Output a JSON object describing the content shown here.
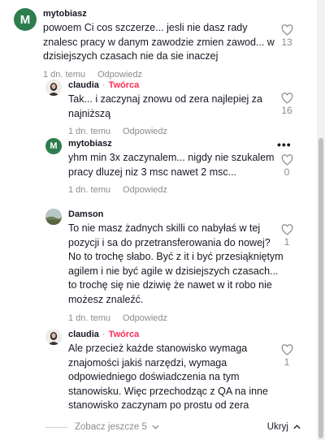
{
  "comments": [
    {
      "username": "mytobiasz",
      "avatar_letter": "M",
      "text": "powoem Ci cos szczerze... jesli nie dasz rady znalesc pracy w danym zawodzie zmien zawod... w dzisiejszych czasach nie da sie inaczej",
      "time": "1 dn. temu",
      "reply": "Odpowiedz",
      "likes": "13"
    },
    {
      "username": "claudia",
      "badge": "Twórca",
      "text": "Tak... i zaczynaj znowu od zera najlepiej za najniższą",
      "time": "1 dn. temu",
      "reply": "Odpowiedz",
      "likes": "16"
    },
    {
      "username": "mytobiasz",
      "avatar_letter": "M",
      "text": "yhm min 3x zaczynalem... nigdy nie szukalem pracy dluzej niz 3 msc nawet 2 msc...",
      "time": "1 dn. temu",
      "reply": "Odpowiedz",
      "likes": "0",
      "more": "•••"
    },
    {
      "username": "Damson",
      "text": "To nie masz żadnych skilli co nabyłaś w tej pozycji i sa do przetransferowania do nowej? No to trochę słabo. Być z it i być przesiąkniętym agilem i nie być agile w dzisiejszych czasach... to trochę się nie dziwię że nawet w it robo nie możesz znaleźć.",
      "time": "1 dn. temu",
      "reply": "Odpowiedz",
      "likes": "1"
    },
    {
      "username": "claudia",
      "badge": "Twórca",
      "text": "Ale przecież każde stanowisko wymaga znajomości jakiś narzędzi, wymaga odpowiedniego doświadczenia na tym stanowisku. Więc przechodząc z QA na inne stanowisko zaczynam po prostu od zera",
      "time": "1 dn. temu",
      "reply": "Odpowiedz",
      "likes": "1"
    }
  ],
  "footer": {
    "see_more": "Zobacz jeszcze 5",
    "hide": "Ukryj"
  },
  "colors": {
    "creator_badge": "#fe2c55",
    "avatar_green": "#2e7d4f",
    "muted_text": "#8a8b91"
  }
}
